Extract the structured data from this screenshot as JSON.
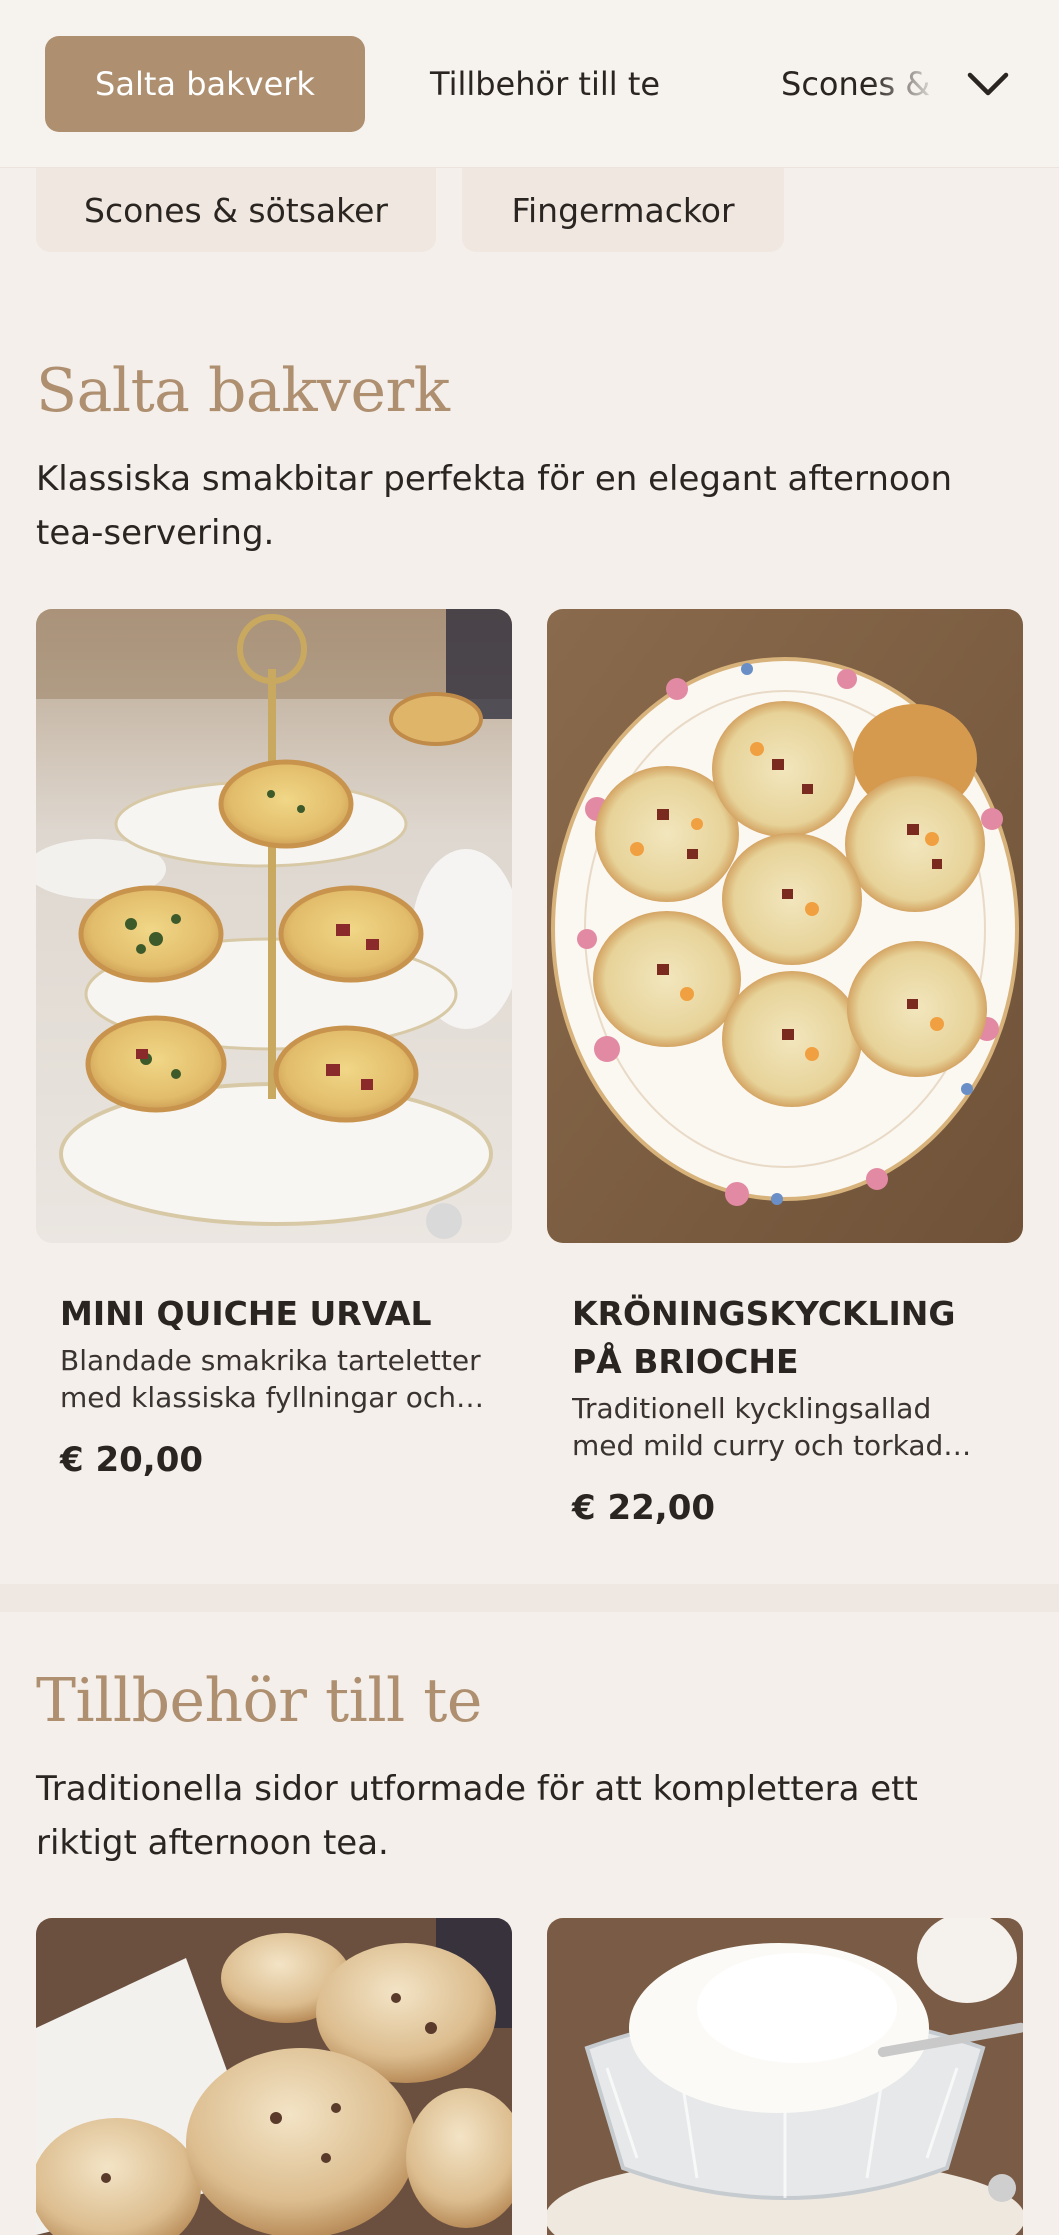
{
  "nav": {
    "active_tab": "Salta bakverk",
    "tabs": [
      "Tillbehör till te",
      "Scones & sötsaker"
    ],
    "chips": [
      "Scones & sötsaker",
      "Fingermackor"
    ]
  },
  "sections": [
    {
      "title": "Salta bakverk",
      "description": "Klassiska smakbitar perfekta för en elegant afternoon tea-servering.",
      "products": [
        {
          "name": "Mini quiche urval",
          "description": "Blandade smakrika tarteletter med klassiska fyllningar och örter.",
          "price": "€ 20,00",
          "image": "mini-quiche-on-tiered-stand"
        },
        {
          "name": "Kröningskyckling på brioche",
          "description": "Traditionell kycklingsallad med mild curry och torkad aprikos.",
          "price": "€ 22,00",
          "image": "coronation-chicken-brioche-plate"
        }
      ]
    },
    {
      "title": "Tillbehör till te",
      "description": "Traditionella sidor utformade för att komplettera ett riktigt afternoon tea.",
      "products": [
        {
          "image": "scones-in-basket"
        },
        {
          "image": "clotted-cream-in-glass-bowl"
        }
      ]
    }
  ],
  "icons": {
    "chevron": "chevron-down-icon"
  },
  "colors": {
    "accent": "#ae8f70",
    "background": "#f4efea",
    "text": "#2b2522"
  }
}
